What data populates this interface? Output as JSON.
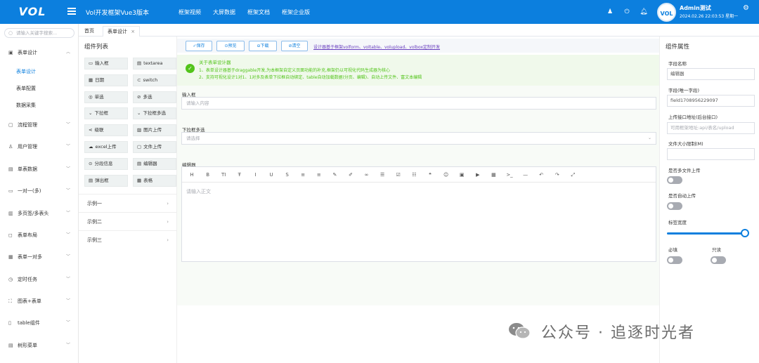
{
  "header": {
    "logo": "VOL",
    "app_title": "Vol开发框架Vue3版本",
    "nav": [
      "框架视频",
      "大屏数据",
      "框架文档",
      "框架企业版"
    ],
    "user_name": "Admin测试",
    "user_time": "2024.02.26 22:03:53 星期一",
    "avatar_text": "VOL"
  },
  "sidebar": {
    "search_placeholder": "请输入关键字搜索...",
    "menus": [
      {
        "icon": "form-icon",
        "glyph": "▣",
        "label": "表单设计",
        "open": true
      },
      {
        "icon": "workflow-icon",
        "glyph": "▢",
        "label": "流程管理"
      },
      {
        "icon": "user-icon",
        "glyph": "♙",
        "label": "用户管理"
      },
      {
        "icon": "table-icon",
        "glyph": "▤",
        "label": "单表数据"
      },
      {
        "icon": "relation-icon",
        "glyph": "▭",
        "label": "一对一(多)"
      },
      {
        "icon": "tabs-icon",
        "glyph": "▥",
        "label": "多页签/多表头"
      },
      {
        "icon": "layout-icon",
        "glyph": "◻",
        "label": "表单布局"
      },
      {
        "icon": "onetomany-icon",
        "glyph": "▦",
        "label": "表单一对多"
      },
      {
        "icon": "clock-icon",
        "glyph": "◷",
        "label": "定时任务"
      },
      {
        "icon": "chart-icon",
        "glyph": "⛶",
        "label": "图表+表单"
      },
      {
        "icon": "tablecomp-icon",
        "glyph": "▯",
        "label": "table组件"
      },
      {
        "icon": "tree-icon",
        "glyph": "▤",
        "label": "树形菜单"
      }
    ],
    "sub_items": [
      "表单设计",
      "表单配置",
      "数据采集"
    ]
  },
  "tabs": {
    "home": "首页",
    "active": "表单设计",
    "close": "×"
  },
  "components": {
    "title": "组件列表",
    "items": [
      {
        "glyph": "▭",
        "label": "输入框"
      },
      {
        "glyph": "▤",
        "label": "textarea"
      },
      {
        "glyph": "▦",
        "label": "日期"
      },
      {
        "glyph": "⊂",
        "label": "switch"
      },
      {
        "glyph": "◎",
        "label": "单选"
      },
      {
        "glyph": "⊘",
        "label": "多选"
      },
      {
        "glyph": "⌄",
        "label": "下拉框"
      },
      {
        "glyph": "⌄",
        "label": "下拉框多选"
      },
      {
        "glyph": "⋖",
        "label": "级联"
      },
      {
        "glyph": "▨",
        "label": "图片上传"
      },
      {
        "glyph": "☁",
        "label": "excel上传"
      },
      {
        "glyph": "▢",
        "label": "文件上传"
      },
      {
        "glyph": "⊙",
        "label": "分段信息"
      },
      {
        "glyph": "▤",
        "label": "编辑器"
      },
      {
        "glyph": "▤",
        "label": "弹出框"
      },
      {
        "glyph": "▦",
        "label": "表格"
      }
    ],
    "examples": [
      "示例一",
      "示例二",
      "示例三"
    ],
    "arrow": "›"
  },
  "toolbar": {
    "buttons": [
      "✓保存",
      "⊙预览",
      "⊖下载",
      "⊘清空"
    ],
    "link": "设计器基于框架volform、voltable、volupload、volbox定制开发"
  },
  "notice": {
    "title": "关于表单设计器",
    "line1": "1、表单设计器基于draggable开发,为本框架自定义页面功能的补充,框架仍以可视化代码生成器为核心",
    "line2": "2、支持可视化设计1对1、1对多及表单下拉框自动绑定、table自动加载数据(分页、编辑)、自动上传文件、富文本编辑"
  },
  "form": {
    "input_label": "输入框",
    "input_placeholder": "请输入内容",
    "select_label": "下拉框多选",
    "select_placeholder": "请选择",
    "editor_label": "编辑器",
    "editor_placeholder": "请输入正文",
    "editor_tools": [
      "H",
      "B",
      "TI",
      "Ŧ",
      "I",
      "U",
      "S",
      "≡",
      "≡",
      "✎",
      "✐",
      "∞",
      "☰",
      "☑",
      "☷",
      "❝",
      "☺",
      "▣",
      "▶",
      "▦",
      ">_",
      "—",
      "↶",
      "↷",
      "⤢"
    ]
  },
  "props": {
    "title": "组件属性",
    "field_name_label": "字段名称",
    "field_name_value": "编辑器",
    "field_key_label": "字段(唯一字段)",
    "field_key_value": "field1708956229097",
    "upload_url_label": "上传接口地址(后台接口)",
    "upload_url_placeholder": "可用框架地址:api/表名/upload",
    "size_label": "文件大小限制(M)",
    "multi_label": "是否多文件上传",
    "auto_label": "是否自动上传",
    "width_label": "标签宽度",
    "width_value": 1.0,
    "required_label": "必填",
    "readonly_label": "只读"
  },
  "watermark": "公众号 · 追逐时光者",
  "colors": {
    "primary": "#0c7fde",
    "success": "#52c41a",
    "link": "#6a40bf"
  }
}
